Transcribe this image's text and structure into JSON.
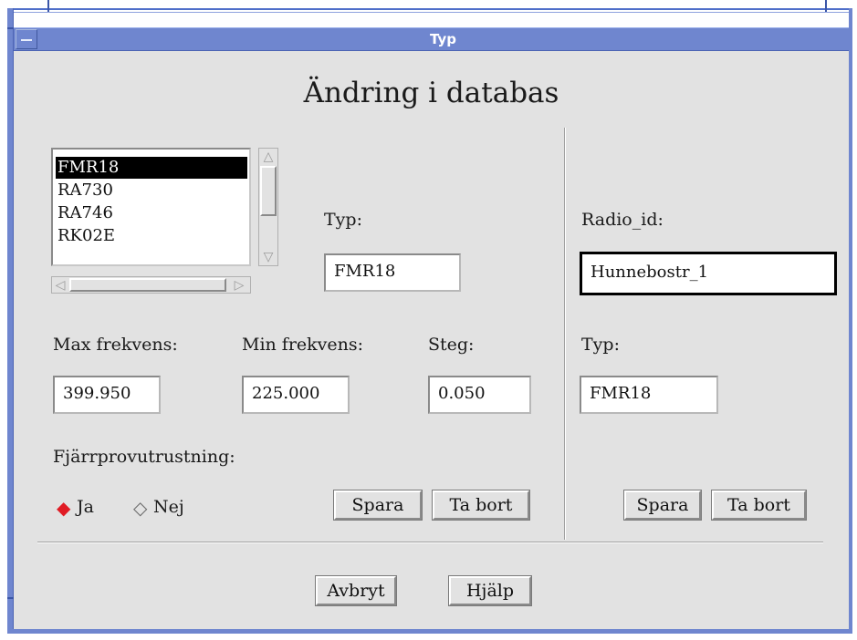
{
  "window": {
    "title": "Typ"
  },
  "dialog": {
    "heading": "Ändring i databas"
  },
  "left_panel": {
    "type_list": {
      "items": [
        "FMR18",
        "RA730",
        "RA746",
        "RK02E"
      ],
      "selected": "FMR18"
    },
    "type_label": "Typ:",
    "type_value": "FMR18",
    "max_freq_label": "Max frekvens:",
    "max_freq_value": "399.950",
    "min_freq_label": "Min frekvens:",
    "min_freq_value": "225.000",
    "step_label": "Steg:",
    "step_value": "0.050",
    "remote_test_label": "Fjärrprovutrustning:",
    "radio_yes": "Ja",
    "radio_no": "Nej",
    "radio_selected": "Ja",
    "save_label": "Spara",
    "delete_label": "Ta bort"
  },
  "right_panel": {
    "radio_id_label": "Radio_id:",
    "radio_id_value": "Hunnebostr_1",
    "type_label": "Typ:",
    "type_value": "FMR18",
    "save_label": "Spara",
    "delete_label": "Ta bort"
  },
  "footer": {
    "cancel_label": "Avbryt",
    "help_label": "Hjälp"
  },
  "colors": {
    "title_bar": "#6f86cf",
    "client_bg": "#e2e2e2",
    "radio_selected": "#e01b24"
  },
  "icons": {
    "window_menu": "window-menu-icon",
    "radio_on": "radio-selected-icon",
    "radio_off": "radio-unselected-icon",
    "scroll_up": "scroll-up-arrow-icon",
    "scroll_down": "scroll-down-arrow-icon",
    "scroll_left": "scroll-left-arrow-icon",
    "scroll_right": "scroll-right-arrow-icon"
  }
}
